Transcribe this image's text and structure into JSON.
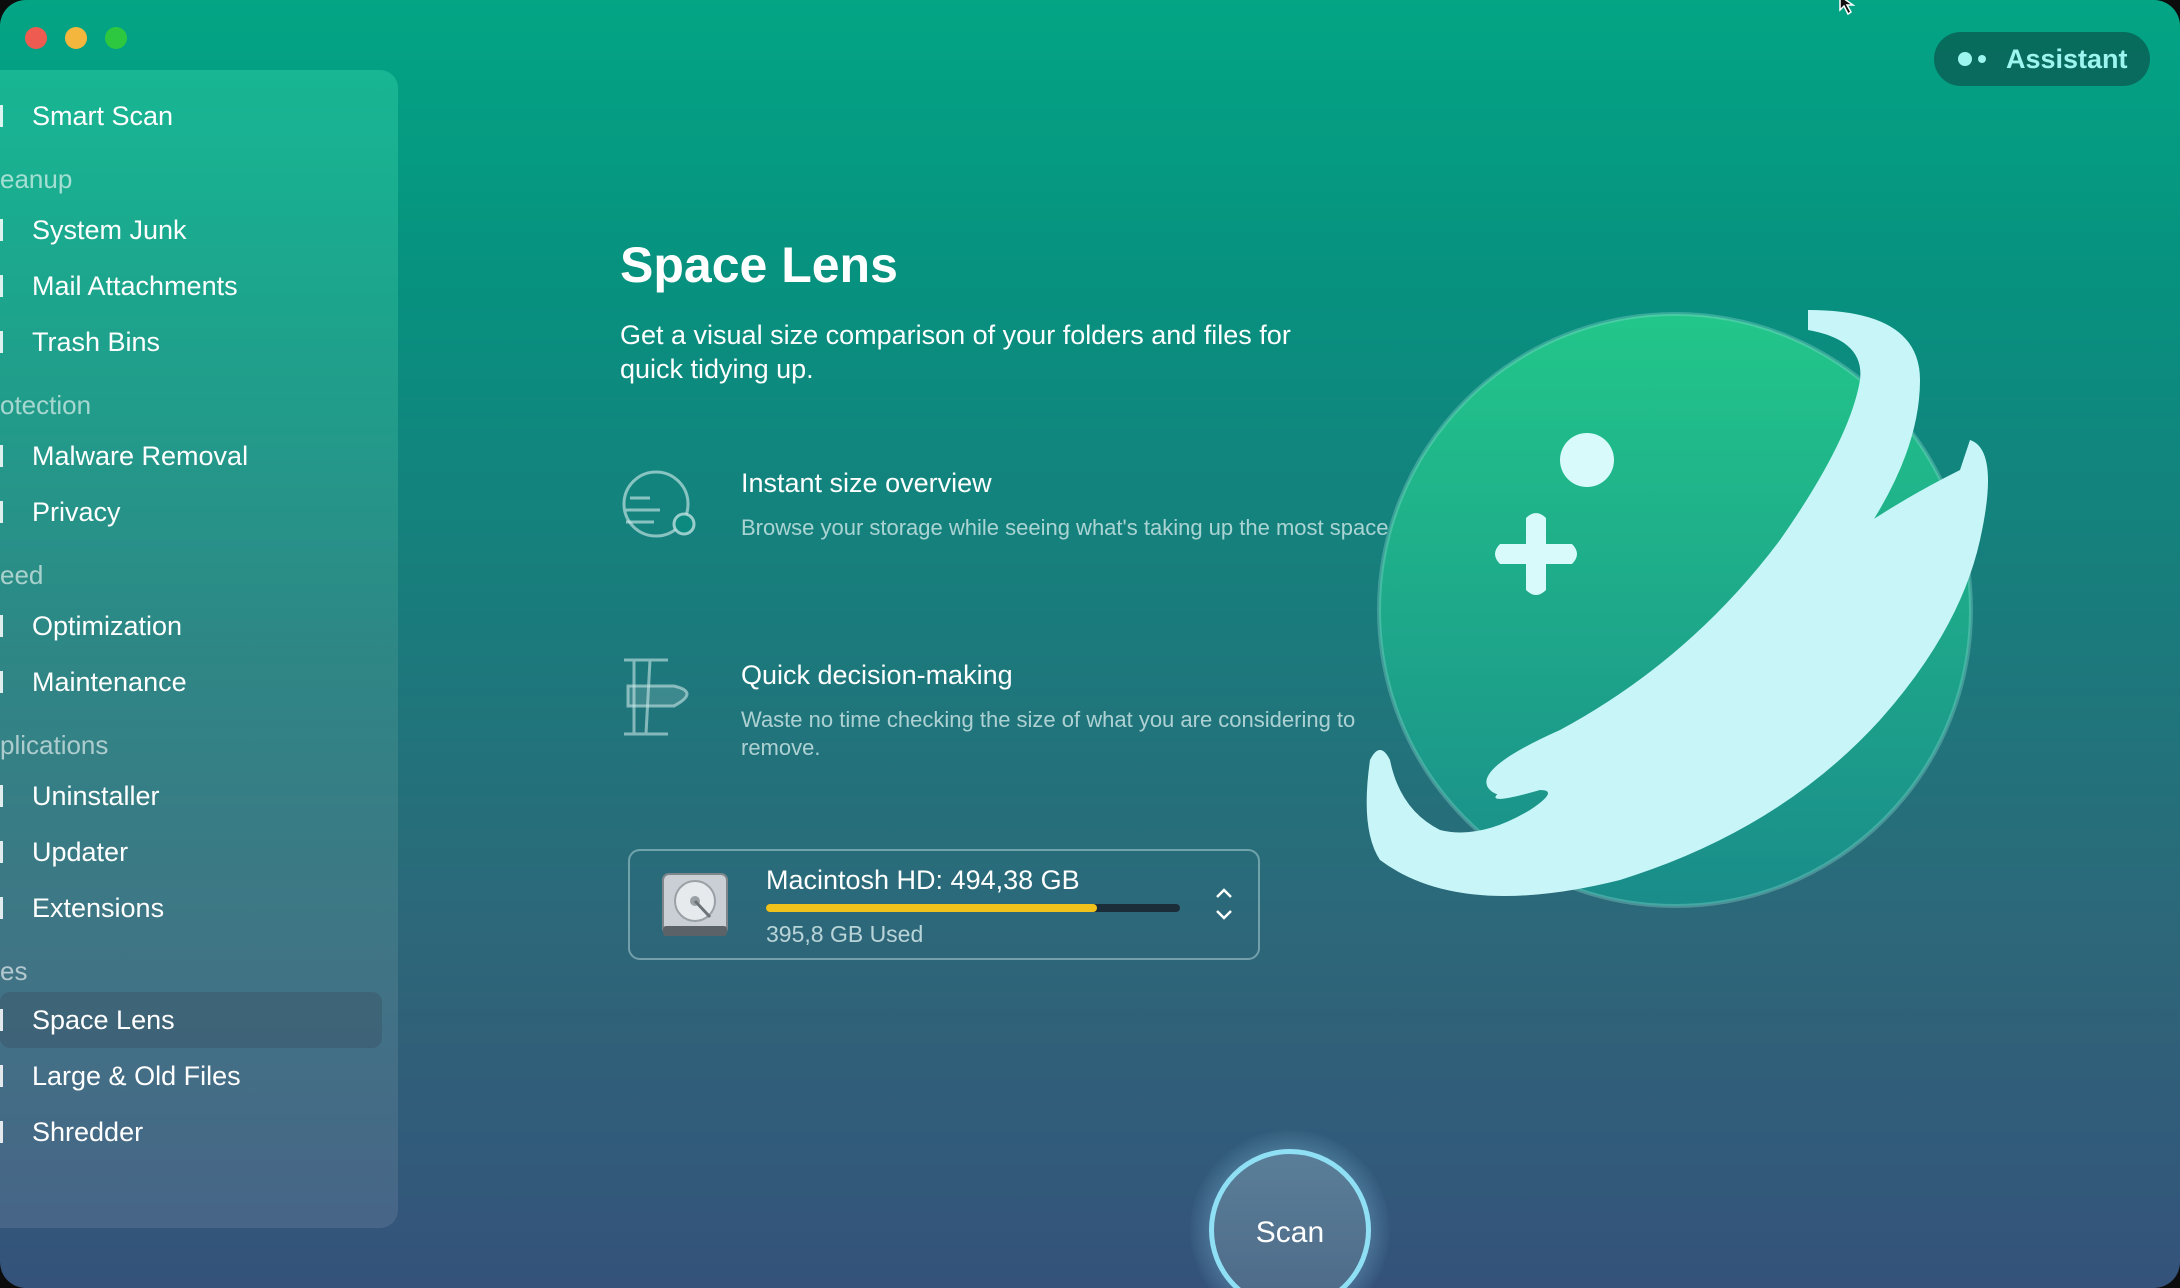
{
  "window": {
    "controls": [
      "close",
      "minimize",
      "zoom"
    ]
  },
  "sidebar": {
    "items": [
      {
        "label": "Smart Scan",
        "type": "item"
      },
      {
        "label": "eanup",
        "type": "section"
      },
      {
        "label": "System Junk",
        "type": "item"
      },
      {
        "label": "Mail Attachments",
        "type": "item"
      },
      {
        "label": "Trash Bins",
        "type": "item"
      },
      {
        "label": "otection",
        "type": "section"
      },
      {
        "label": "Malware Removal",
        "type": "item"
      },
      {
        "label": "Privacy",
        "type": "item"
      },
      {
        "label": "eed",
        "type": "section"
      },
      {
        "label": "Optimization",
        "type": "item"
      },
      {
        "label": "Maintenance",
        "type": "item"
      },
      {
        "label": "plications",
        "type": "section"
      },
      {
        "label": "Uninstaller",
        "type": "item"
      },
      {
        "label": "Updater",
        "type": "item"
      },
      {
        "label": "Extensions",
        "type": "item"
      },
      {
        "label": "es",
        "type": "section"
      },
      {
        "label": "Space Lens",
        "type": "item",
        "active": true
      },
      {
        "label": "Large & Old Files",
        "type": "item"
      },
      {
        "label": "Shredder",
        "type": "item"
      }
    ]
  },
  "header": {
    "assistant_label": "Assistant"
  },
  "main": {
    "title": "Space Lens",
    "subtitle": "Get a visual size comparison of your folders and files for quick tidying up.",
    "features": [
      {
        "title": "Instant size overview",
        "description": "Browse your storage while seeing what's taking up the most space.",
        "icon": "size-overview-icon"
      },
      {
        "title": "Quick decision-making",
        "description": "Waste no time checking the size of what you are considering to remove.",
        "icon": "decision-icon"
      }
    ],
    "disk": {
      "name": "Macintosh HD: 494,38 GB",
      "used_label": "395,8 GB Used",
      "used_fraction": 0.8,
      "bar_color": "#f1c21b"
    },
    "scan_label": "Scan"
  },
  "colors": {
    "accent": "#8fe0f4",
    "planet": "#1fc08a",
    "ring": "#c8f6f8"
  }
}
